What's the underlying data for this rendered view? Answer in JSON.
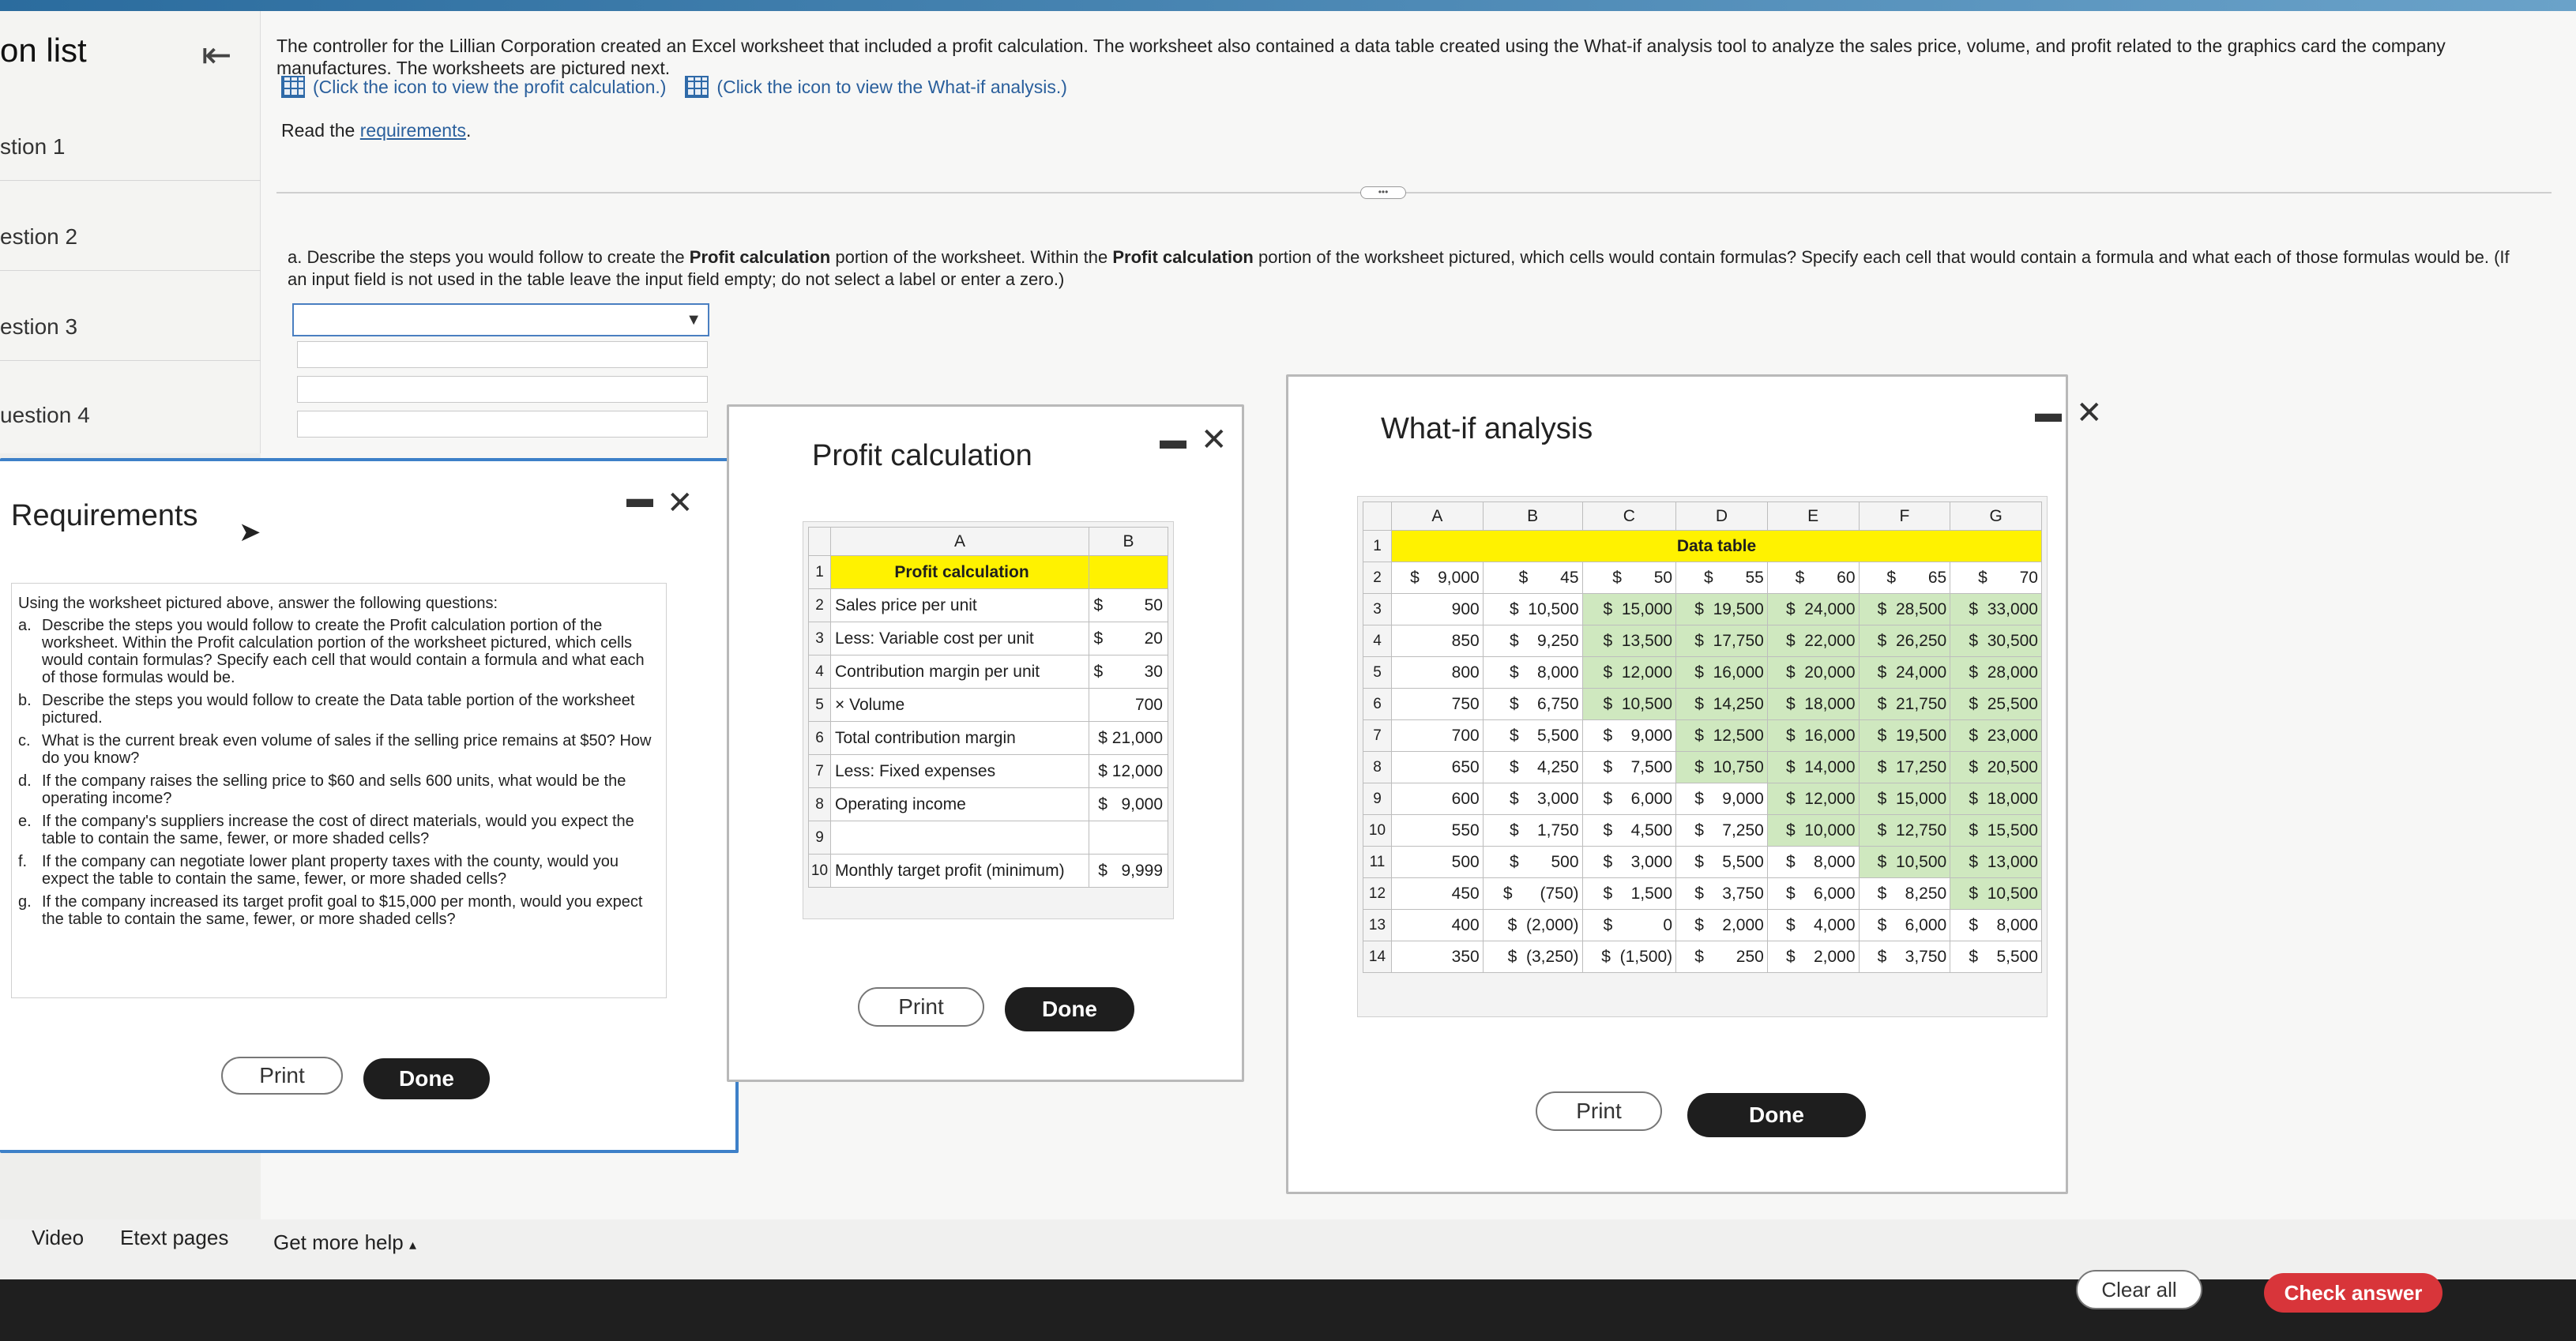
{
  "sidebar": {
    "title": "on list",
    "items": [
      "stion 1",
      "estion 2",
      "estion 3",
      "uestion 4"
    ]
  },
  "intro": {
    "text": "The controller for the Lillian Corporation created an Excel worksheet that included a profit calculation. The worksheet also contained a data table created using the What-if analysis tool to analyze the sales price, volume, and profit related to the graphics card the company manufactures. The worksheets are pictured next.",
    "link_profit": "(Click the icon to view the profit calculation.)",
    "link_whatif": "(Click the icon to view the What-if analysis.)",
    "read_prefix": "Read the",
    "read_link": "requirements",
    "read_suffix": "."
  },
  "question": {
    "label": "a.",
    "text_1": "Describe the steps you would follow to create the",
    "bold_1": "Profit calculation",
    "text_2": "portion of the worksheet. Within the",
    "bold_2": "Profit calculation",
    "text_3": "portion of the worksheet pictured, which cells would contain formulas? Specify each cell that would contain a formula and what each of those formulas would be.",
    "hint": "(If an input field is not used in the table leave the input field empty; do not select a label or enter a zero.)",
    "dropdown_value": ""
  },
  "requirements": {
    "title": "Requirements",
    "intro": "Using the worksheet pictured above, answer the following questions:",
    "items": [
      {
        "letter": "a.",
        "text": "Describe the steps you would follow to create the Profit calculation portion of the worksheet. Within the Profit calculation portion of the worksheet pictured, which cells would contain formulas? Specify each cell that would contain a formula and what each of those formulas would be."
      },
      {
        "letter": "b.",
        "text": "Describe the steps you would follow to create the Data table portion of the worksheet pictured."
      },
      {
        "letter": "c.",
        "text": "What is the current break even volume of sales if the selling price remains at $50? How do you know?"
      },
      {
        "letter": "d.",
        "text": "If the company raises the selling price to $60 and sells 600 units, what would be the operating income?"
      },
      {
        "letter": "e.",
        "text": "If the company's suppliers increase the cost of direct materials, would you expect the table to contain the same, fewer, or more shaded cells?"
      },
      {
        "letter": "f.",
        "text": "If the company can negotiate lower plant property taxes with the county, would you expect the table to contain the same, fewer, or more shaded cells?"
      },
      {
        "letter": "g.",
        "text": "If the company increased its target profit goal to $15,000 per month, would you expect the table to contain the same, fewer, or more shaded cells?"
      }
    ],
    "print": "Print",
    "done": "Done"
  },
  "profit": {
    "title": "Profit calculation",
    "col_a": "A",
    "col_b": "B",
    "rows": [
      {
        "n": "1",
        "a": "Profit calculation",
        "b": ""
      },
      {
        "n": "2",
        "a": "Sales price per unit",
        "b": "$         50"
      },
      {
        "n": "3",
        "a": "Less: Variable cost per unit",
        "b": "$         20"
      },
      {
        "n": "4",
        "a": "Contribution margin per unit",
        "b": "$         30"
      },
      {
        "n": "5",
        "a": "× Volume",
        "b": "700"
      },
      {
        "n": "6",
        "a": "Total contribution margin",
        "b": "$ 21,000"
      },
      {
        "n": "7",
        "a": "Less: Fixed expenses",
        "b": "$ 12,000"
      },
      {
        "n": "8",
        "a": "Operating income",
        "b": "$   9,000"
      },
      {
        "n": "9",
        "a": "",
        "b": ""
      },
      {
        "n": "10",
        "a": "Monthly target profit (minimum)",
        "b": "$   9,999"
      }
    ],
    "print": "Print",
    "done": "Done"
  },
  "whatif": {
    "title": "What-if analysis",
    "cols": [
      "A",
      "B",
      "C",
      "D",
      "E",
      "F",
      "G"
    ],
    "row1_label": "Data table",
    "rows": [
      [
        "$    9,000",
        "$       45",
        "$       50",
        "$       55",
        "$       60",
        "$       65",
        "$       70"
      ],
      [
        "900",
        "$  10,500",
        "$  15,000",
        "$  19,500",
        "$  24,000",
        "$  28,500",
        "$  33,000"
      ],
      [
        "850",
        "$    9,250",
        "$  13,500",
        "$  17,750",
        "$  22,000",
        "$  26,250",
        "$  30,500"
      ],
      [
        "800",
        "$    8,000",
        "$  12,000",
        "$  16,000",
        "$  20,000",
        "$  24,000",
        "$  28,000"
      ],
      [
        "750",
        "$    6,750",
        "$  10,500",
        "$  14,250",
        "$  18,000",
        "$  21,750",
        "$  25,500"
      ],
      [
        "700",
        "$    5,500",
        "$    9,000",
        "$  12,500",
        "$  16,000",
        "$  19,500",
        "$  23,000"
      ],
      [
        "650",
        "$    4,250",
        "$    7,500",
        "$  10,750",
        "$  14,000",
        "$  17,250",
        "$  20,500"
      ],
      [
        "600",
        "$    3,000",
        "$    6,000",
        "$    9,000",
        "$  12,000",
        "$  15,000",
        "$  18,000"
      ],
      [
        "550",
        "$    1,750",
        "$    4,500",
        "$    7,250",
        "$  10,000",
        "$  12,750",
        "$  15,500"
      ],
      [
        "500",
        "$       500",
        "$    3,000",
        "$    5,500",
        "$    8,000",
        "$  10,500",
        "$  13,000"
      ],
      [
        "450",
        "$      (750)",
        "$    1,500",
        "$    3,750",
        "$    6,000",
        "$    8,250",
        "$  10,500"
      ],
      [
        "400",
        "$  (2,000)",
        "$           0",
        "$    2,000",
        "$    4,000",
        "$    6,000",
        "$    8,000"
      ],
      [
        "350",
        "$  (3,250)",
        "$  (1,500)",
        "$       250",
        "$    2,000",
        "$    3,750",
        "$    5,500"
      ]
    ],
    "shaded": [
      [
        false,
        false,
        false,
        false,
        false,
        false,
        false
      ],
      [
        false,
        false,
        true,
        true,
        true,
        true,
        true
      ],
      [
        false,
        false,
        true,
        true,
        true,
        true,
        true
      ],
      [
        false,
        false,
        true,
        true,
        true,
        true,
        true
      ],
      [
        false,
        false,
        true,
        true,
        true,
        true,
        true
      ],
      [
        false,
        false,
        false,
        true,
        true,
        true,
        true
      ],
      [
        false,
        false,
        false,
        true,
        true,
        true,
        true
      ],
      [
        false,
        false,
        false,
        false,
        true,
        true,
        true
      ],
      [
        false,
        false,
        false,
        false,
        true,
        true,
        true
      ],
      [
        false,
        false,
        false,
        false,
        false,
        true,
        true
      ],
      [
        false,
        false,
        false,
        false,
        false,
        false,
        true
      ],
      [
        false,
        false,
        false,
        false,
        false,
        false,
        false
      ],
      [
        false,
        false,
        false,
        false,
        false,
        false,
        false
      ]
    ],
    "print": "Print",
    "done": "Done"
  },
  "footer": {
    "video": "Video",
    "etext": "Etext pages",
    "help": "Get more help",
    "help_caret": "▴",
    "clear": "Clear all",
    "check": "Check answer"
  },
  "icons": {
    "collapse": "collapse-sidebar-icon",
    "cursor": "cursor-icon",
    "minimize": "minimize-icon",
    "close": "close-icon"
  },
  "colors": {
    "header_fill": "#fff200",
    "shaded_cell": "#cfe8bf",
    "check_button": "#d8353a",
    "link": "#2a5f9c"
  }
}
